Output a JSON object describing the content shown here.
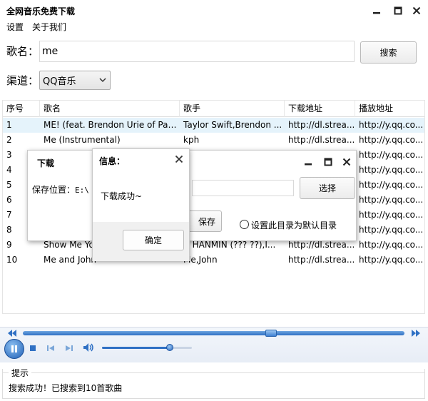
{
  "window": {
    "title": "全网音乐免费下载",
    "minimize_icon": "minimize-icon",
    "maximize_icon": "maximize-icon",
    "close_icon": "close-icon"
  },
  "menu": {
    "items": [
      "设置",
      "关于我们"
    ]
  },
  "search": {
    "label": "歌名：",
    "value": "me",
    "button": "搜索"
  },
  "channel": {
    "label": "渠道：",
    "selected": "QQ音乐"
  },
  "table": {
    "headers": [
      "序号",
      "歌名",
      "歌手",
      "下载地址",
      "播放地址"
    ],
    "rows": [
      [
        "1",
        "ME! (feat. Brendon Urie of Pan...",
        "Taylor Swift,Brendon ...",
        "http://dl.strea...",
        "http://y.qq.co..."
      ],
      [
        "2",
        "Me (Instrumental)",
        "kph",
        "http://dl.strea...",
        "http://y.qq.co..."
      ],
      [
        "3",
        "",
        "",
        "",
        "http://y.qq.co..."
      ],
      [
        "4",
        "",
        "",
        "",
        "http://y.qq.co..."
      ],
      [
        "5",
        "",
        "",
        "",
        "http://y.qq.co..."
      ],
      [
        "6",
        "",
        "",
        "",
        "http://y.qq.co..."
      ],
      [
        "7",
        "",
        "",
        "",
        "http://y.qq.co..."
      ],
      [
        "8",
        "",
        "",
        "",
        "http://y.qq.co..."
      ],
      [
        "9",
        "Show Me Yo",
        "U HANMIN (??? ??),I...",
        "http://dl.strea...",
        "http://y.qq.co..."
      ],
      [
        "10",
        "Me and John",
        "Me,John",
        "http://dl.strea...",
        "http://y.qq.co..."
      ]
    ],
    "selected_row": 1
  },
  "download_dialog": {
    "title": "下载",
    "save_label": "保存位置：",
    "path_value": "E:\\",
    "choose_button": "选择",
    "save_button": "保存",
    "default_dir_label": "设置此目录为默认目录"
  },
  "info_dialog": {
    "title": "信息：",
    "message": "下载成功~",
    "ok_button": "确定"
  },
  "player": {
    "progress": 0.65,
    "volume": 0.75
  },
  "status": {
    "legend": "提示",
    "message": "搜索成功！已搜索到10首歌曲"
  },
  "colors": {
    "selection": "#e5f3fb",
    "accent": "#2f70c4"
  }
}
